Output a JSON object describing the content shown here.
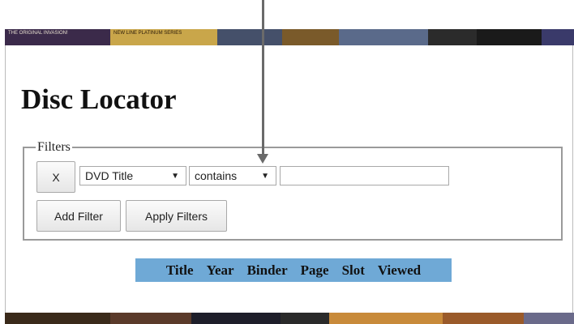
{
  "banner": {
    "covers": [
      {
        "text": "THE ORIGINAL INVASION!",
        "color": "#3b2a4a"
      },
      {
        "text": "NEW LINE PLATINUM SERIES",
        "color": "#c9a64a"
      },
      {
        "text": "",
        "color": "#45506a"
      },
      {
        "text": "",
        "color": "#7a5a2a"
      },
      {
        "text": "",
        "color": "#5a6a8a"
      },
      {
        "text": "",
        "color": "#2b2b2b"
      },
      {
        "text": "",
        "color": "#1a1a1a"
      },
      {
        "text": "",
        "color": "#3a3a6a"
      }
    ]
  },
  "bottom_banner": {
    "covers": [
      {
        "text": "",
        "color": "#3a2a1a"
      },
      {
        "text": "",
        "color": "#5a3a2a"
      },
      {
        "text": "",
        "color": "#1e1e2a"
      },
      {
        "text": "",
        "color": "#2a2a2a"
      },
      {
        "text": "",
        "color": "#c88a3a"
      },
      {
        "text": "",
        "color": "#9a5a2a"
      },
      {
        "text": "",
        "color": "#6a6a8a"
      }
    ]
  },
  "page": {
    "title": "Disc Locator"
  },
  "filters": {
    "legend": "Filters",
    "remove_label": "X",
    "field_select": "DVD Title",
    "operator_select": "contains",
    "value_input": "",
    "add_filter_label": "Add Filter",
    "apply_filters_label": "Apply Filters"
  },
  "results": {
    "columns": [
      "Title",
      "Year",
      "Binder",
      "Page",
      "Slot",
      "Viewed"
    ]
  },
  "colors": {
    "table_header_bg": "#6fa9d6",
    "annotation_arrow": "#6a6a6a"
  }
}
